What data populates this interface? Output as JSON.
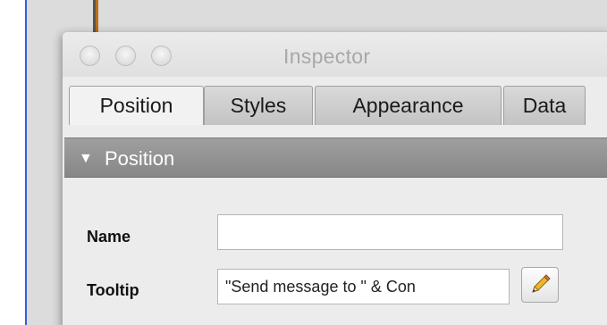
{
  "window": {
    "title": "Inspector"
  },
  "tabs": [
    {
      "label": "Position",
      "active": true
    },
    {
      "label": "Styles",
      "active": false
    },
    {
      "label": "Appearance",
      "active": false
    },
    {
      "label": "Data",
      "active": false
    }
  ],
  "section": {
    "toggle_glyph": "▼",
    "title": "Position",
    "expanded": true
  },
  "fields": {
    "name": {
      "label": "Name",
      "value": ""
    },
    "tooltip": {
      "label": "Tooltip",
      "value": "\"Send message to \" & Con"
    }
  },
  "icons": {
    "edit": "pencil-icon"
  },
  "colors": {
    "section_header": "#8f8f8f",
    "accent_blue": "#3a5cd8",
    "accent_orange": "#b86f17"
  }
}
